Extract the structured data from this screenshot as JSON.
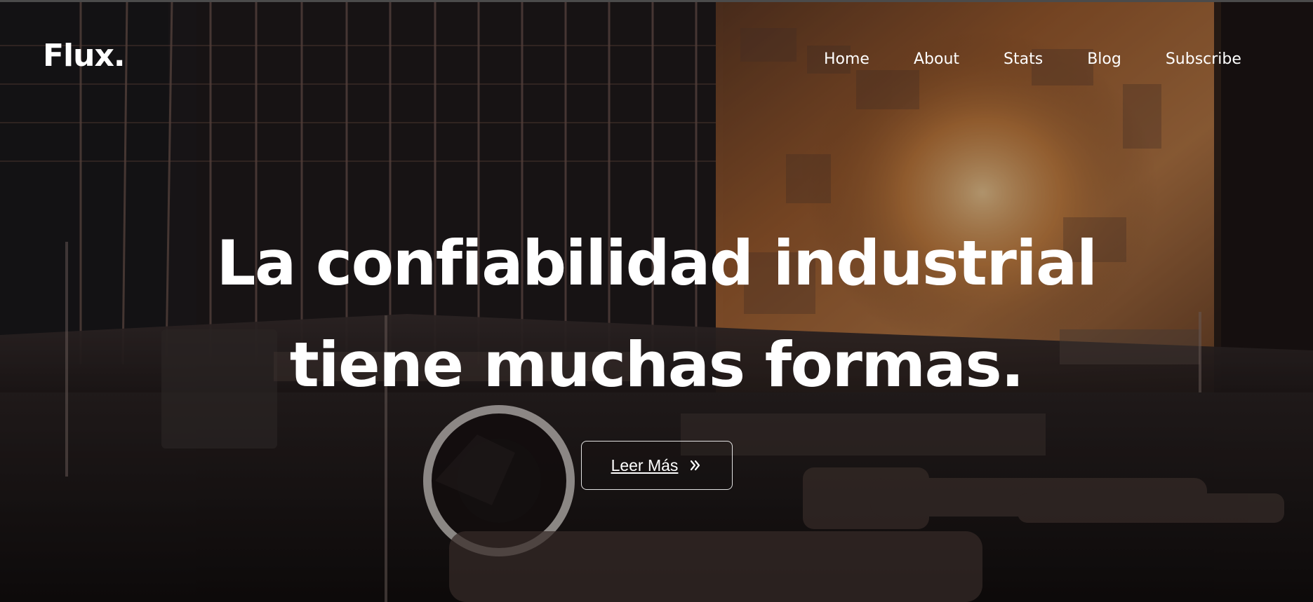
{
  "brand": {
    "logo_text": "Flux."
  },
  "nav": {
    "items": [
      {
        "label": "Home"
      },
      {
        "label": "About"
      },
      {
        "label": "Stats"
      },
      {
        "label": "Blog"
      },
      {
        "label": "Subscribe"
      }
    ]
  },
  "hero": {
    "headline_line_1": "La confiabilidad industrial",
    "headline_line_2": "tiene muchas formas.",
    "cta_label": "Leer Más",
    "cta_icon": "double-chevron-right-icon",
    "background_image": "industrial-forge-workshop-image"
  },
  "colors": {
    "text": "#ffffff",
    "overlay": "#000000",
    "accent_fire": "#d07830",
    "background_dark": "#110d0d"
  }
}
